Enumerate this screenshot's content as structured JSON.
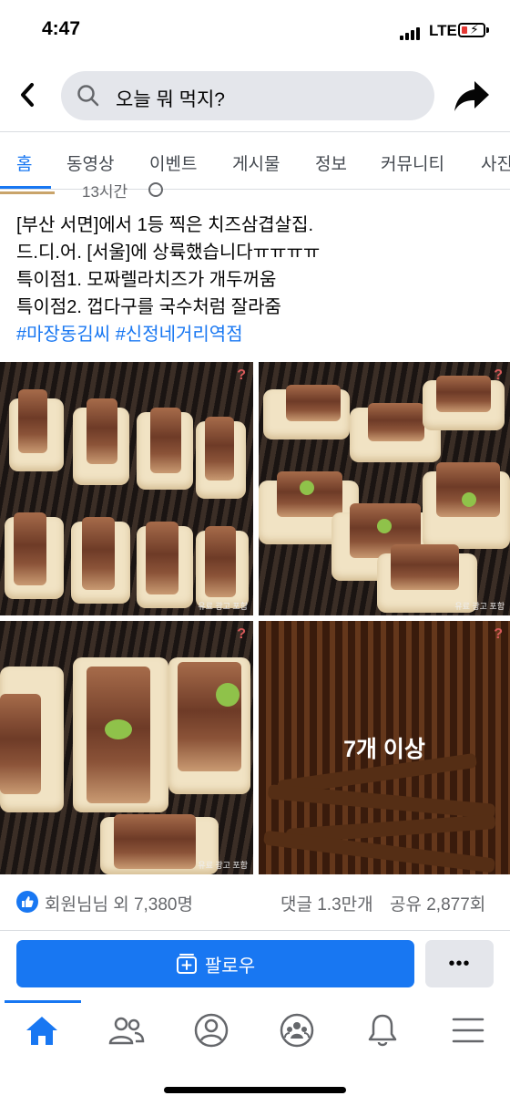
{
  "status_bar": {
    "time": "4:47",
    "network": "LTE",
    "battery_state": "low-charging"
  },
  "header": {
    "search_query": "오늘 뭐 먹지?",
    "back_icon": "chevron-left-icon",
    "share_icon": "share-arrow-icon"
  },
  "tabs": [
    {
      "label": "홈",
      "active": true
    },
    {
      "label": "동영상",
      "active": false
    },
    {
      "label": "이벤트",
      "active": false
    },
    {
      "label": "게시물",
      "active": false
    },
    {
      "label": "정보",
      "active": false
    },
    {
      "label": "커뮤니티",
      "active": false
    },
    {
      "label": "사진",
      "active": false
    }
  ],
  "post": {
    "time": "13시간",
    "text_lines": [
      "[부산 서면]에서 1등 찍은 치즈삼겹살집.",
      "드.디.어. [서울]에 상륙했습니다ㅠㅠㅠㅠ",
      "특이점1. 모짜렐라치즈가 개두꺼움",
      "특이점2. 껍다구를 국수처럼 잘라줌"
    ],
    "hashtags": [
      "#마장동김씨",
      "#신정네거리역점"
    ],
    "photos": [
      {
        "badge": "?",
        "ad_label": "유료 광고 포함"
      },
      {
        "badge": "?",
        "ad_label": "유료 광고 포함"
      },
      {
        "badge": "?",
        "ad_label": "유료 광고 포함"
      },
      {
        "badge": "?",
        "more_label": "7개 이상"
      }
    ]
  },
  "reactions": {
    "likes": "회원님님 외 7,380명",
    "comments": "댓글 1.3만개",
    "shares": "공유 2,877회"
  },
  "actions": {
    "follow_label": "팔로우",
    "more_label": "•••"
  },
  "bottom_nav": [
    "home-icon",
    "friends-icon",
    "profile-icon",
    "groups-icon",
    "bell-icon",
    "menu-icon"
  ],
  "colors": {
    "accent": "#1877f2",
    "bg_gray": "#e4e6eb",
    "text_secondary": "#65676b"
  }
}
